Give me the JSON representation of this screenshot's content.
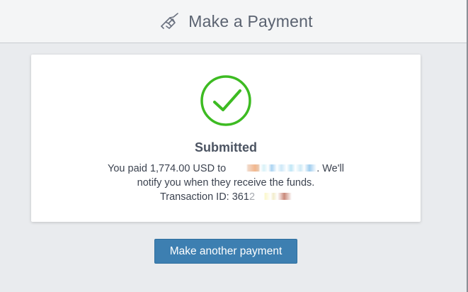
{
  "header": {
    "title": "Make a Payment",
    "icon": "handshake-icon"
  },
  "confirmation": {
    "icon": "check-circle-icon",
    "status": "Submitted",
    "line1_prefix": "You paid 1,774.00 USD to",
    "line1_suffix": ". We'll",
    "line2": "notify you when they receive the funds.",
    "line3_prefix": "Transaction ID: 361",
    "line3_partial": "2"
  },
  "actions": {
    "primary_label": "Make another payment"
  },
  "colors": {
    "accent": "#3d7fb1",
    "success": "#3dbb22",
    "header_bg": "#f4f5f6",
    "page_bg": "#e9ebee"
  }
}
